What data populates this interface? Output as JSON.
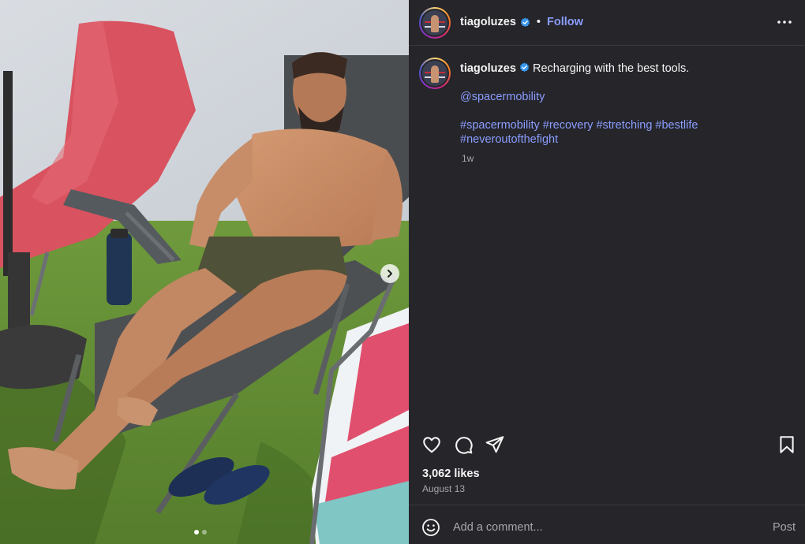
{
  "post": {
    "author": {
      "username": "tiagoluzes",
      "verified": true,
      "avatar": "avatar-image"
    },
    "header": {
      "separator": "•",
      "follow_label": "Follow",
      "more_icon": "more-horizontal-icon"
    },
    "caption": {
      "username": "tiagoluzes",
      "text": "Recharging with the best tools.",
      "mention": "@spacermobility",
      "hashtags_line1": "#spacermobility #recovery #stretching #bestlife",
      "hashtags_line2": "#neveroutofthefight",
      "time_ago": "1w"
    },
    "media": {
      "description": "photo",
      "carousel": {
        "total": 2,
        "active_index": 0
      },
      "next_icon": "chevron-right-icon"
    },
    "actions": {
      "like_icon": "heart-icon",
      "comment_icon": "comment-icon",
      "share_icon": "paper-plane-icon",
      "save_icon": "bookmark-icon"
    },
    "likes_text": "3,062 likes",
    "date": "August 13",
    "comment_bar": {
      "emoji_icon": "emoji-icon",
      "placeholder": "Add a comment...",
      "post_label": "Post"
    }
  },
  "colors": {
    "panel_bg": "#25252a",
    "link": "#8b9dff",
    "muted": "#a8a8a8",
    "verified_blue": "#3897f0"
  }
}
